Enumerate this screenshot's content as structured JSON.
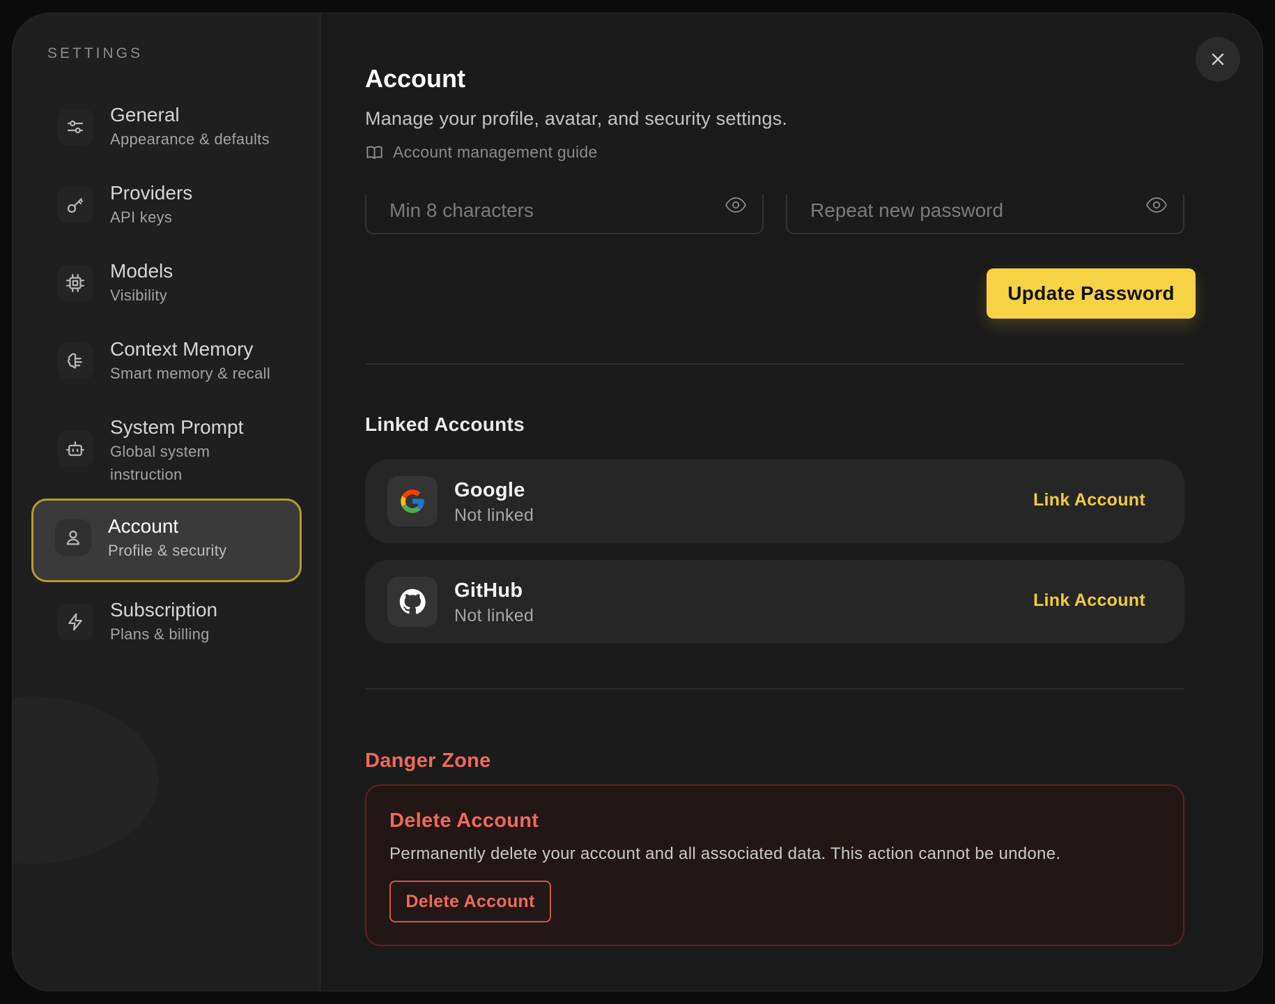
{
  "sidebar": {
    "heading": "SETTINGS",
    "items": [
      {
        "title": "General",
        "subtitle": "Appearance & defaults",
        "icon": "sliders-icon"
      },
      {
        "title": "Providers",
        "subtitle": "API keys",
        "icon": "key-icon"
      },
      {
        "title": "Models",
        "subtitle": "Visibility",
        "icon": "chip-icon"
      },
      {
        "title": "Context Memory",
        "subtitle": "Smart memory & recall",
        "icon": "brain-icon"
      },
      {
        "title": "System Prompt",
        "subtitle": "Global system instruction",
        "icon": "bot-icon"
      },
      {
        "title": "Account",
        "subtitle": "Profile & security",
        "icon": "user-icon",
        "active": true
      },
      {
        "title": "Subscription",
        "subtitle": "Plans & billing",
        "icon": "bolt-icon"
      }
    ]
  },
  "main": {
    "title": "Account",
    "description": "Manage your profile, avatar, and security settings.",
    "guide_link": "Account management guide",
    "password": {
      "new_placeholder": "Min 8 characters",
      "confirm_placeholder": "Repeat new password",
      "update_label": "Update Password"
    },
    "linked_accounts": {
      "title": "Linked Accounts",
      "items": [
        {
          "name": "Google",
          "status": "Not linked",
          "action": "Link Account",
          "icon": "google-icon"
        },
        {
          "name": "GitHub",
          "status": "Not linked",
          "action": "Link Account",
          "icon": "github-icon"
        }
      ]
    },
    "danger_zone": {
      "title": "Danger Zone",
      "box_title": "Delete Account",
      "description": "Permanently delete your account and all associated data. This action cannot be undone.",
      "button_label": "Delete Account"
    }
  },
  "colors": {
    "accent": "#f6d245",
    "danger": "#ef6a5a",
    "active_border": "#b59c2e",
    "background": "#1b1b1b"
  }
}
